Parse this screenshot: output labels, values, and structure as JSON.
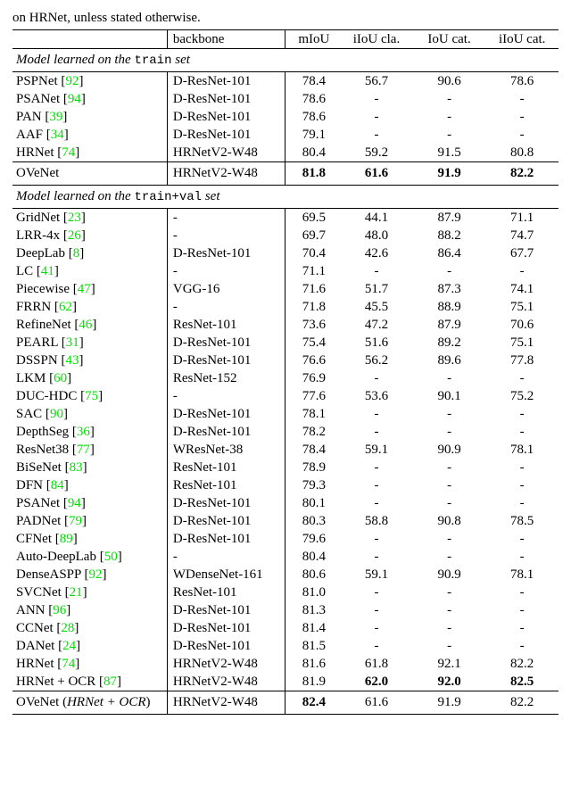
{
  "caption_frag": "on HRNet, unless stated otherwise.",
  "headers": {
    "backbone": "backbone",
    "miou": "mIoU",
    "iiou_cla": "iIoU cla.",
    "iou_cat": "IoU cat.",
    "iiou_cat": "iIoU cat."
  },
  "sections": [
    {
      "title_pre": "Model learned on the ",
      "title_code": "train",
      "title_post": " set",
      "rows": [
        {
          "name": "PSPNet",
          "cite": "92",
          "bb": "D-ResNet-101",
          "miou": "78.4",
          "iiou_cla": "56.7",
          "iou_cat": "90.6",
          "iiou_cat": "78.6"
        },
        {
          "name": "PSANet",
          "cite": "94",
          "bb": "D-ResNet-101",
          "miou": "78.6",
          "iiou_cla": "-",
          "iou_cat": "-",
          "iiou_cat": "-"
        },
        {
          "name": "PAN",
          "cite": "39",
          "bb": "D-ResNet-101",
          "miou": "78.6",
          "iiou_cla": "-",
          "iou_cat": "-",
          "iiou_cat": "-"
        },
        {
          "name": "AAF",
          "cite": "34",
          "bb": "D-ResNet-101",
          "miou": "79.1",
          "iiou_cla": "-",
          "iou_cat": "-",
          "iiou_cat": "-"
        },
        {
          "name": "HRNet",
          "cite": "74",
          "bb": "HRNetV2-W48",
          "miou": "80.4",
          "iiou_cla": "59.2",
          "iou_cat": "91.5",
          "iiou_cat": "80.8"
        }
      ],
      "footer": {
        "name": "OVeNet",
        "bb": "HRNetV2-W48",
        "miou": "81.8",
        "iiou_cla": "61.6",
        "iou_cat": "91.9",
        "iiou_cat": "82.2",
        "bold": [
          "miou",
          "iiou_cla",
          "iou_cat",
          "iiou_cat"
        ]
      }
    },
    {
      "title_pre": "Model learned on the ",
      "title_code": "train+val",
      "title_post": " set",
      "rows": [
        {
          "name": "GridNet",
          "cite": "23",
          "bb": "-",
          "miou": "69.5",
          "iiou_cla": "44.1",
          "iou_cat": "87.9",
          "iiou_cat": "71.1"
        },
        {
          "name": "LRR-4x",
          "cite": "26",
          "bb": "-",
          "miou": "69.7",
          "iiou_cla": "48.0",
          "iou_cat": "88.2",
          "iiou_cat": "74.7"
        },
        {
          "name": "DeepLab",
          "cite": "8",
          "bb": "D-ResNet-101",
          "miou": "70.4",
          "iiou_cla": "42.6",
          "iou_cat": "86.4",
          "iiou_cat": "67.7"
        },
        {
          "name": "LC",
          "cite": "41",
          "bb": "-",
          "miou": "71.1",
          "iiou_cla": "-",
          "iou_cat": "-",
          "iiou_cat": "-"
        },
        {
          "name": "Piecewise",
          "cite": "47",
          "bb": "VGG-16",
          "miou": "71.6",
          "iiou_cla": "51.7",
          "iou_cat": "87.3",
          "iiou_cat": "74.1"
        },
        {
          "name": "FRRN",
          "cite": "62",
          "bb": "-",
          "miou": "71.8",
          "iiou_cla": "45.5",
          "iou_cat": "88.9",
          "iiou_cat": "75.1"
        },
        {
          "name": "RefineNet",
          "cite": "46",
          "bb": "ResNet-101",
          "miou": "73.6",
          "iiou_cla": "47.2",
          "iou_cat": "87.9",
          "iiou_cat": "70.6"
        },
        {
          "name": "PEARL",
          "cite": "31",
          "bb": "D-ResNet-101",
          "miou": "75.4",
          "iiou_cla": "51.6",
          "iou_cat": "89.2",
          "iiou_cat": "75.1"
        },
        {
          "name": "DSSPN",
          "cite": "43",
          "bb": "D-ResNet-101",
          "miou": "76.6",
          "iiou_cla": "56.2",
          "iou_cat": "89.6",
          "iiou_cat": "77.8"
        },
        {
          "name": "LKM",
          "cite": "60",
          "bb": "ResNet-152",
          "miou": "76.9",
          "iiou_cla": "-",
          "iou_cat": "-",
          "iiou_cat": "-"
        },
        {
          "name": "DUC-HDC",
          "cite": "75",
          "bb": "-",
          "miou": "77.6",
          "iiou_cla": "53.6",
          "iou_cat": "90.1",
          "iiou_cat": "75.2"
        },
        {
          "name": "SAC",
          "cite": "90",
          "bb": "D-ResNet-101",
          "miou": "78.1",
          "iiou_cla": "-",
          "iou_cat": "-",
          "iiou_cat": "-"
        },
        {
          "name": "DepthSeg",
          "cite": "36",
          "bb": "D-ResNet-101",
          "miou": "78.2",
          "iiou_cla": "-",
          "iou_cat": "-",
          "iiou_cat": "-"
        },
        {
          "name": "ResNet38",
          "cite": "77",
          "bb": "WResNet-38",
          "miou": "78.4",
          "iiou_cla": "59.1",
          "iou_cat": "90.9",
          "iiou_cat": "78.1"
        },
        {
          "name": "BiSeNet",
          "cite": "83",
          "bb": "ResNet-101",
          "miou": "78.9",
          "iiou_cla": "-",
          "iou_cat": "-",
          "iiou_cat": "-"
        },
        {
          "name": "DFN",
          "cite": "84",
          "bb": "ResNet-101",
          "miou": "79.3",
          "iiou_cla": "-",
          "iou_cat": "-",
          "iiou_cat": "-"
        },
        {
          "name": "PSANet",
          "cite": "94",
          "bb": "D-ResNet-101",
          "miou": "80.1",
          "iiou_cla": "-",
          "iou_cat": "-",
          "iiou_cat": "-"
        },
        {
          "name": "PADNet",
          "cite": "79",
          "bb": "D-ResNet-101",
          "miou": "80.3",
          "iiou_cla": "58.8",
          "iou_cat": "90.8",
          "iiou_cat": "78.5"
        },
        {
          "name": "CFNet",
          "cite": "89",
          "bb": "D-ResNet-101",
          "miou": "79.6",
          "iiou_cla": "-",
          "iou_cat": "-",
          "iiou_cat": "-"
        },
        {
          "name": "Auto-DeepLab",
          "cite": "50",
          "bb": "-",
          "miou": "80.4",
          "iiou_cla": "-",
          "iou_cat": "-",
          "iiou_cat": "-"
        },
        {
          "name": "DenseASPP",
          "cite": "92",
          "bb": "WDenseNet-161",
          "miou": "80.6",
          "iiou_cla": "59.1",
          "iou_cat": "90.9",
          "iiou_cat": "78.1"
        },
        {
          "name": "SVCNet",
          "cite": "21",
          "bb": "ResNet-101",
          "miou": "81.0",
          "iiou_cla": "-",
          "iou_cat": "-",
          "iiou_cat": "-"
        },
        {
          "name": "ANN",
          "cite": "96",
          "bb": "D-ResNet-101",
          "miou": "81.3",
          "iiou_cla": "-",
          "iou_cat": "-",
          "iiou_cat": "-"
        },
        {
          "name": "CCNet",
          "cite": "28",
          "bb": "D-ResNet-101",
          "miou": "81.4",
          "iiou_cla": "-",
          "iou_cat": "-",
          "iiou_cat": "-"
        },
        {
          "name": "DANet",
          "cite": "24",
          "bb": "D-ResNet-101",
          "miou": "81.5",
          "iiou_cla": "-",
          "iou_cat": "-",
          "iiou_cat": "-"
        },
        {
          "name": "HRNet",
          "cite": "74",
          "bb": "HRNetV2-W48",
          "miou": "81.6",
          "iiou_cla": "61.8",
          "iou_cat": "92.1",
          "iiou_cat": "82.2"
        },
        {
          "name": "HRNet + OCR",
          "cite": "87",
          "bb": "HRNetV2-W48",
          "miou": "81.9",
          "iiou_cla": "62.0",
          "iou_cat": "92.0",
          "iiou_cat": "82.5",
          "bold": [
            "iiou_cla",
            "iou_cat",
            "iiou_cat"
          ]
        }
      ],
      "footer": {
        "name_html": "OVeNet (<i>HRNet + OCR</i>)",
        "bb": "HRNetV2-W48",
        "miou": "82.4",
        "iiou_cla": "61.6",
        "iou_cat": "91.9",
        "iiou_cat": "82.2",
        "bold": [
          "miou"
        ]
      }
    }
  ]
}
